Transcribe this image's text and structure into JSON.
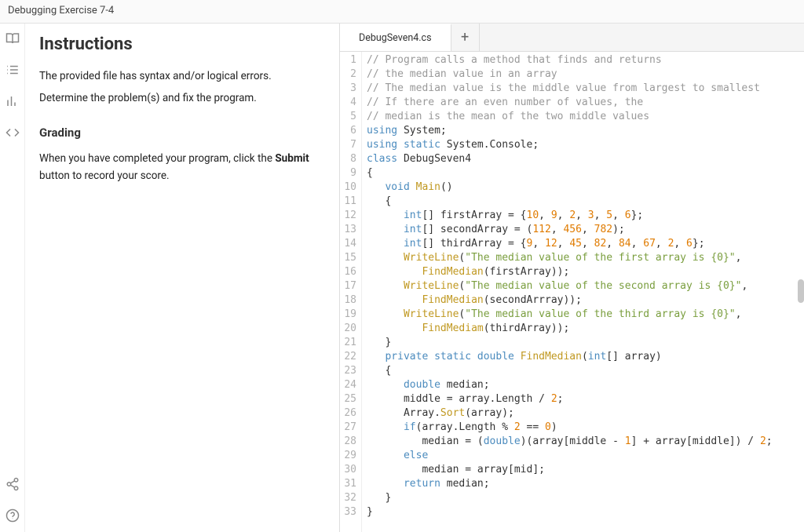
{
  "title": "Debugging Exercise 7-4",
  "left": {
    "heading": "Instructions",
    "p1a": "The provided file has syntax and/or logical errors.",
    "p1b": "Determine the problem(s) and fix the program.",
    "grading": "Grading",
    "p2a": "When you have completed your program, click the ",
    "p2b": "Submit",
    "p2c": " button to record your score."
  },
  "tabs": {
    "file": "DebugSeven4.cs",
    "plus": "+"
  },
  "code": {
    "lines": [
      [
        {
          "t": "// Program calls a method that finds and returns",
          "c": "c-comment"
        }
      ],
      [
        {
          "t": "// the median value in an array",
          "c": "c-comment"
        }
      ],
      [
        {
          "t": "// The median value is the middle value from largest to smallest",
          "c": "c-comment"
        }
      ],
      [
        {
          "t": "// If there are an even number of values, the",
          "c": "c-comment"
        }
      ],
      [
        {
          "t": "// median is the mean of the two middle values",
          "c": "c-comment"
        }
      ],
      [
        {
          "t": "using",
          "c": "c-key"
        },
        {
          "t": " System;",
          "c": ""
        }
      ],
      [
        {
          "t": "using static",
          "c": "c-key"
        },
        {
          "t": " System.Console;",
          "c": ""
        }
      ],
      [
        {
          "t": "class",
          "c": "c-key"
        },
        {
          "t": " DebugSeven4",
          "c": "c-cls"
        }
      ],
      [
        {
          "t": "{",
          "c": ""
        }
      ],
      [
        {
          "t": "   ",
          "c": ""
        },
        {
          "t": "void",
          "c": "c-key"
        },
        {
          "t": " ",
          "c": ""
        },
        {
          "t": "Main",
          "c": "c-func"
        },
        {
          "t": "()",
          "c": ""
        }
      ],
      [
        {
          "t": "   {",
          "c": ""
        }
      ],
      [
        {
          "t": "      ",
          "c": ""
        },
        {
          "t": "int",
          "c": "c-key"
        },
        {
          "t": "[] firstArray = {",
          "c": ""
        },
        {
          "t": "10",
          "c": "c-num"
        },
        {
          "t": ", ",
          "c": ""
        },
        {
          "t": "9",
          "c": "c-num"
        },
        {
          "t": ", ",
          "c": ""
        },
        {
          "t": "2",
          "c": "c-num"
        },
        {
          "t": ", ",
          "c": ""
        },
        {
          "t": "3",
          "c": "c-num"
        },
        {
          "t": ", ",
          "c": ""
        },
        {
          "t": "5",
          "c": "c-num"
        },
        {
          "t": ", ",
          "c": ""
        },
        {
          "t": "6",
          "c": "c-num"
        },
        {
          "t": "};",
          "c": ""
        }
      ],
      [
        {
          "t": "      ",
          "c": ""
        },
        {
          "t": "int",
          "c": "c-key"
        },
        {
          "t": "[] secondArray = (",
          "c": ""
        },
        {
          "t": "112",
          "c": "c-num"
        },
        {
          "t": ", ",
          "c": ""
        },
        {
          "t": "456",
          "c": "c-num"
        },
        {
          "t": ", ",
          "c": ""
        },
        {
          "t": "782",
          "c": "c-num"
        },
        {
          "t": ");",
          "c": ""
        }
      ],
      [
        {
          "t": "      ",
          "c": ""
        },
        {
          "t": "int",
          "c": "c-key"
        },
        {
          "t": "[] thirdArray = {",
          "c": ""
        },
        {
          "t": "9",
          "c": "c-num"
        },
        {
          "t": ", ",
          "c": ""
        },
        {
          "t": "12",
          "c": "c-num"
        },
        {
          "t": ", ",
          "c": ""
        },
        {
          "t": "45",
          "c": "c-num"
        },
        {
          "t": ", ",
          "c": ""
        },
        {
          "t": "82",
          "c": "c-num"
        },
        {
          "t": ", ",
          "c": ""
        },
        {
          "t": "84",
          "c": "c-num"
        },
        {
          "t": ", ",
          "c": ""
        },
        {
          "t": "67",
          "c": "c-num"
        },
        {
          "t": ", ",
          "c": ""
        },
        {
          "t": "2",
          "c": "c-num"
        },
        {
          "t": ", ",
          "c": ""
        },
        {
          "t": "6",
          "c": "c-num"
        },
        {
          "t": "};",
          "c": ""
        }
      ],
      [
        {
          "t": "      ",
          "c": ""
        },
        {
          "t": "WriteLine",
          "c": "c-func"
        },
        {
          "t": "(",
          "c": ""
        },
        {
          "t": "\"The median value of the first array is {0}\"",
          "c": "c-str"
        },
        {
          "t": ",",
          "c": ""
        }
      ],
      [
        {
          "t": "         ",
          "c": ""
        },
        {
          "t": "FindMedian",
          "c": "c-func"
        },
        {
          "t": "(firstArray));",
          "c": ""
        }
      ],
      [
        {
          "t": "      ",
          "c": ""
        },
        {
          "t": "WriteLine",
          "c": "c-func"
        },
        {
          "t": "(",
          "c": ""
        },
        {
          "t": "\"The median value of the second array is {0}\"",
          "c": "c-str"
        },
        {
          "t": ",",
          "c": ""
        }
      ],
      [
        {
          "t": "         ",
          "c": ""
        },
        {
          "t": "FindMedian",
          "c": "c-func"
        },
        {
          "t": "(secondArrray));",
          "c": ""
        }
      ],
      [
        {
          "t": "      ",
          "c": ""
        },
        {
          "t": "WriteLine",
          "c": "c-func"
        },
        {
          "t": "(",
          "c": ""
        },
        {
          "t": "\"The median value of the third array is {0}\"",
          "c": "c-str"
        },
        {
          "t": ",",
          "c": ""
        }
      ],
      [
        {
          "t": "         ",
          "c": ""
        },
        {
          "t": "FindMediam",
          "c": "c-func"
        },
        {
          "t": "(thirdArray));",
          "c": ""
        }
      ],
      [
        {
          "t": "   }",
          "c": ""
        }
      ],
      [
        {
          "t": "   ",
          "c": ""
        },
        {
          "t": "private static",
          "c": "c-key"
        },
        {
          "t": " ",
          "c": ""
        },
        {
          "t": "double",
          "c": "c-key"
        },
        {
          "t": " ",
          "c": ""
        },
        {
          "t": "FindMedian",
          "c": "c-func"
        },
        {
          "t": "(",
          "c": ""
        },
        {
          "t": "int",
          "c": "c-key"
        },
        {
          "t": "[] array)",
          "c": ""
        }
      ],
      [
        {
          "t": "   {",
          "c": ""
        }
      ],
      [
        {
          "t": "      ",
          "c": ""
        },
        {
          "t": "double",
          "c": "c-key"
        },
        {
          "t": " median;",
          "c": ""
        }
      ],
      [
        {
          "t": "      middle = array.Length / ",
          "c": ""
        },
        {
          "t": "2",
          "c": "c-num"
        },
        {
          "t": ";",
          "c": ""
        }
      ],
      [
        {
          "t": "      Array.",
          "c": ""
        },
        {
          "t": "Sort",
          "c": "c-func"
        },
        {
          "t": "(array);",
          "c": ""
        }
      ],
      [
        {
          "t": "      ",
          "c": ""
        },
        {
          "t": "if",
          "c": "c-key"
        },
        {
          "t": "(array.Length % ",
          "c": ""
        },
        {
          "t": "2",
          "c": "c-num"
        },
        {
          "t": " == ",
          "c": ""
        },
        {
          "t": "0",
          "c": "c-num"
        },
        {
          "t": ")",
          "c": ""
        }
      ],
      [
        {
          "t": "         median = (",
          "c": ""
        },
        {
          "t": "double",
          "c": "c-key"
        },
        {
          "t": ")(array[middle - ",
          "c": ""
        },
        {
          "t": "1",
          "c": "c-num"
        },
        {
          "t": "] + array[middle]) / ",
          "c": ""
        },
        {
          "t": "2",
          "c": "c-num"
        },
        {
          "t": ";",
          "c": ""
        }
      ],
      [
        {
          "t": "      ",
          "c": ""
        },
        {
          "t": "else",
          "c": "c-key"
        }
      ],
      [
        {
          "t": "         median = array[mid];",
          "c": ""
        }
      ],
      [
        {
          "t": "      ",
          "c": ""
        },
        {
          "t": "return",
          "c": "c-key"
        },
        {
          "t": " median;",
          "c": ""
        }
      ],
      [
        {
          "t": "   }",
          "c": ""
        }
      ],
      [
        {
          "t": "}",
          "c": ""
        }
      ]
    ]
  }
}
